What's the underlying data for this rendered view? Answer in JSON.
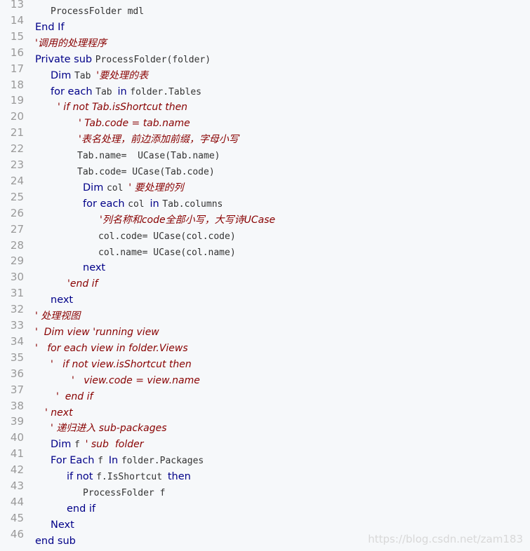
{
  "gutter": {
    "line_numbers": [
      "13",
      "14",
      "15",
      "16",
      "17",
      "18",
      "19",
      "20",
      "21",
      "22",
      "23",
      "24",
      "25",
      "26",
      "27",
      "28",
      "29",
      "30",
      "31",
      "32",
      "33",
      "34",
      "35",
      "36",
      "37",
      "38",
      "39",
      "40",
      "41",
      "42",
      "43",
      "44",
      "45",
      "46"
    ]
  },
  "code": {
    "lines": [
      {
        "indent": 22,
        "tokens": [
          {
            "t": "ProcessFolder mdl",
            "c": "id"
          }
        ]
      },
      {
        "indent": 0,
        "tokens": [
          {
            "t": "End If",
            "c": "kw"
          }
        ]
      },
      {
        "indent": 0,
        "tokens": [
          {
            "t": "'调用的处理程序",
            "c": "cm"
          }
        ]
      },
      {
        "indent": 0,
        "tokens": [
          {
            "t": "Private sub ",
            "c": "kw"
          },
          {
            "t": "ProcessFolder(folder)",
            "c": "id"
          }
        ]
      },
      {
        "indent": 22,
        "tokens": [
          {
            "t": "Dim ",
            "c": "kw"
          },
          {
            "t": "Tab ",
            "c": "id"
          },
          {
            "t": "'要处理的表",
            "c": "cm"
          }
        ]
      },
      {
        "indent": 22,
        "tokens": [
          {
            "t": "for each ",
            "c": "kw"
          },
          {
            "t": "Tab ",
            "c": "id"
          },
          {
            "t": "in ",
            "c": "kw"
          },
          {
            "t": "folder.Tables",
            "c": "id"
          }
        ]
      },
      {
        "indent": 32,
        "tokens": [
          {
            "t": "' if not Tab.isShortcut then",
            "c": "cm"
          }
        ]
      },
      {
        "indent": 62,
        "tokens": [
          {
            "t": "' Tab.code = tab.name",
            "c": "cm"
          }
        ]
      },
      {
        "indent": 62,
        "tokens": [
          {
            "t": "'表名处理，前边添加前缀，字母小写",
            "c": "cm"
          }
        ]
      },
      {
        "indent": 60,
        "tokens": [
          {
            "t": "Tab.name=  UCase(Tab.name)",
            "c": "id"
          }
        ]
      },
      {
        "indent": 60,
        "tokens": [
          {
            "t": "Tab.code= UCase(Tab.code)",
            "c": "id"
          }
        ]
      },
      {
        "indent": 68,
        "tokens": [
          {
            "t": "Dim ",
            "c": "kw"
          },
          {
            "t": "col ",
            "c": "id"
          },
          {
            "t": "' 要处理的列",
            "c": "cm"
          }
        ]
      },
      {
        "indent": 68,
        "tokens": [
          {
            "t": "for each ",
            "c": "kw"
          },
          {
            "t": "col ",
            "c": "id"
          },
          {
            "t": "in ",
            "c": "kw"
          },
          {
            "t": "Tab.columns",
            "c": "id"
          }
        ]
      },
      {
        "indent": 92,
        "tokens": [
          {
            "t": "'列名称和code全部小写，大写诗UCase",
            "c": "cm"
          }
        ]
      },
      {
        "indent": 90,
        "tokens": [
          {
            "t": "col.code= UCase(col.code)",
            "c": "id"
          }
        ]
      },
      {
        "indent": 90,
        "tokens": [
          {
            "t": "col.name= UCase(col.name)",
            "c": "id"
          }
        ]
      },
      {
        "indent": 68,
        "tokens": [
          {
            "t": "next",
            "c": "kw"
          }
        ]
      },
      {
        "indent": 46,
        "tokens": [
          {
            "t": "'end if",
            "c": "cm"
          }
        ]
      },
      {
        "indent": 22,
        "tokens": [
          {
            "t": "next",
            "c": "kw"
          }
        ]
      },
      {
        "indent": 0,
        "tokens": [
          {
            "t": "' 处理视图",
            "c": "cm"
          }
        ]
      },
      {
        "indent": 0,
        "tokens": [
          {
            "t": "'  Dim view 'running view",
            "c": "cm"
          }
        ]
      },
      {
        "indent": 0,
        "tokens": [
          {
            "t": "'   for each view in folder.Views",
            "c": "cm"
          }
        ]
      },
      {
        "indent": 22,
        "tokens": [
          {
            "t": "'   if not view.isShortcut then",
            "c": "cm"
          }
        ]
      },
      {
        "indent": 52,
        "tokens": [
          {
            "t": "'   view.code = view.name",
            "c": "cm"
          }
        ]
      },
      {
        "indent": 30,
        "tokens": [
          {
            "t": "'  end if",
            "c": "cm"
          }
        ]
      },
      {
        "indent": 14,
        "tokens": [
          {
            "t": "' next",
            "c": "cm"
          }
        ]
      },
      {
        "indent": 22,
        "tokens": [
          {
            "t": "' 递归进入 sub-packages",
            "c": "cm"
          }
        ]
      },
      {
        "indent": 22,
        "tokens": [
          {
            "t": "Dim ",
            "c": "kw"
          },
          {
            "t": "f ",
            "c": "id"
          },
          {
            "t": "' sub  folder",
            "c": "cm"
          }
        ]
      },
      {
        "indent": 22,
        "tokens": [
          {
            "t": "For Each ",
            "c": "kw"
          },
          {
            "t": "f ",
            "c": "id"
          },
          {
            "t": "In ",
            "c": "kw"
          },
          {
            "t": "folder.Packages",
            "c": "id"
          }
        ]
      },
      {
        "indent": 45,
        "tokens": [
          {
            "t": "if not ",
            "c": "kw"
          },
          {
            "t": "f.IsShortcut ",
            "c": "id"
          },
          {
            "t": "then",
            "c": "kw"
          }
        ]
      },
      {
        "indent": 68,
        "tokens": [
          {
            "t": "ProcessFolder f",
            "c": "id"
          }
        ]
      },
      {
        "indent": 45,
        "tokens": [
          {
            "t": "end if",
            "c": "kw"
          }
        ]
      },
      {
        "indent": 22,
        "tokens": [
          {
            "t": "Next",
            "c": "kw"
          }
        ]
      },
      {
        "indent": 0,
        "tokens": [
          {
            "t": "end sub",
            "c": "kw"
          }
        ]
      }
    ]
  },
  "watermark": "https://blog.csdn.net/zam183"
}
